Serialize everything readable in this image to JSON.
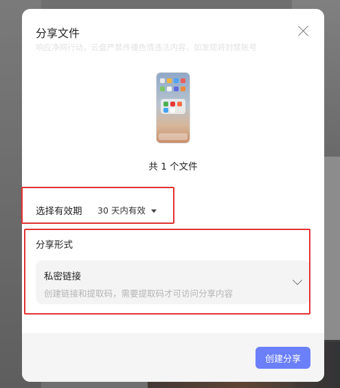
{
  "dialog": {
    "title": "分享文件",
    "notice": "响应净网行动，云盘严禁传播色情违法内容，如发现将封禁账号",
    "file_count_text": "共 1 个文件"
  },
  "validity": {
    "label": "选择有效期",
    "selected": "30 天内有效"
  },
  "share_form": {
    "label": "分享形式",
    "option_title": "私密链接",
    "option_desc": "创建链接和提取码，需要提取码才可访问分享内容"
  },
  "footer": {
    "create_label": "创建分享"
  },
  "colors": {
    "accent": "#6b7ff8",
    "highlight": "#e23030"
  }
}
